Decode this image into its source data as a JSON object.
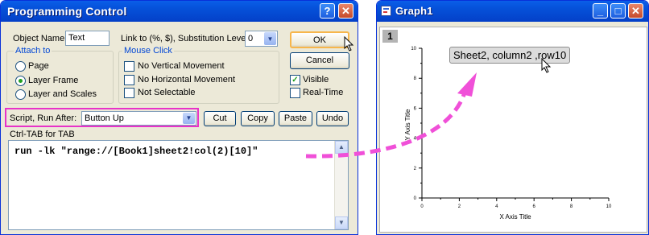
{
  "dialog": {
    "title": "Programming Control",
    "object_name_label": "Object Name",
    "object_name_value": "Text",
    "link_to_label": "Link to (%, $), Substitution Level",
    "substitution_level_value": "0",
    "ok_label": "OK",
    "cancel_label": "Cancel",
    "attach_to": {
      "legend": "Attach to",
      "options": [
        "Page",
        "Layer Frame",
        "Layer and Scales"
      ],
      "selected": "Layer Frame"
    },
    "mouse_click": {
      "legend": "Mouse Click",
      "options": [
        "No Vertical Movement",
        "No Horizontal Movement",
        "Not Selectable"
      ]
    },
    "visible_label": "Visible",
    "visible_checked": true,
    "realtime_label": "Real-Time",
    "realtime_checked": false,
    "script_run_after_label": "Script, Run After:",
    "script_run_after_value": "Button Up",
    "cut_label": "Cut",
    "copy_label": "Copy",
    "paste_label": "Paste",
    "undo_label": "Undo",
    "ctrl_tab_label": "Ctrl-TAB for TAB",
    "script_text": "run -lk \"range://[Book1]sheet2!col(2)[10]\""
  },
  "graph": {
    "title": "Graph1",
    "layer_number": "1",
    "label_text": "Sheet2, column2 ,row10",
    "x_axis_title": "X Axis Title",
    "y_axis_title": "Y Axis Title",
    "x_ticks": [
      "0",
      "2",
      "4",
      "6",
      "8",
      "10"
    ],
    "y_ticks": [
      "0",
      "2",
      "4",
      "6",
      "8",
      "10"
    ]
  },
  "colors": {
    "title_bar": "#0550d8",
    "highlight_box": "#e832c8",
    "arrow": "#f050d8",
    "dialog_bg": "#ece9d8"
  }
}
